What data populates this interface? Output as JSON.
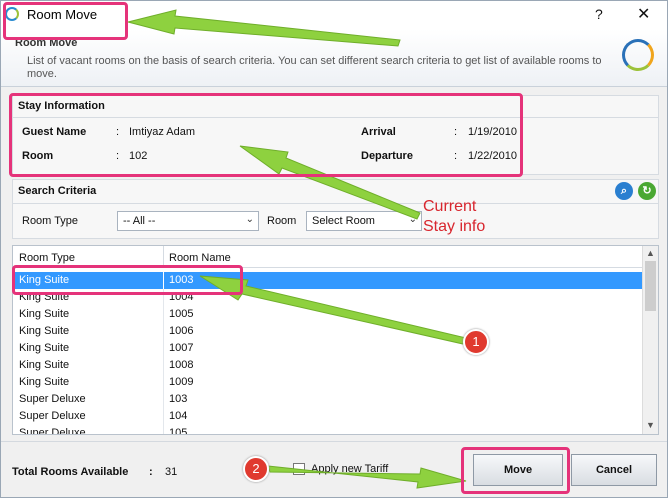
{
  "window": {
    "title": "Room Move",
    "help": "?",
    "close": "✕"
  },
  "header": {
    "title": "Room Move",
    "description": "List of vacant rooms on the basis of search criteria. You can set different search criteria to get list of available rooms to move."
  },
  "stay": {
    "title": "Stay Information",
    "guest_label": "Guest Name",
    "guest_value": "Imtiyaz Adam",
    "room_label": "Room",
    "room_value": "102",
    "arrival_label": "Arrival",
    "arrival_value": "1/19/2010",
    "departure_label": "Departure",
    "departure_value": "1/22/2010",
    "colon": ":"
  },
  "search": {
    "title": "Search Criteria",
    "room_type_label": "Room Type",
    "room_type_value": "-- All --",
    "room_label": "Room",
    "room_value": "Select Room"
  },
  "grid": {
    "headers": [
      "Room Type",
      "Room Name"
    ],
    "rows": [
      [
        "King Suite",
        "1003"
      ],
      [
        "King Suite",
        "1004"
      ],
      [
        "King Suite",
        "1005"
      ],
      [
        "King Suite",
        "1006"
      ],
      [
        "King Suite",
        "1007"
      ],
      [
        "King Suite",
        "1008"
      ],
      [
        "King Suite",
        "1009"
      ],
      [
        "Super Deluxe",
        "103"
      ],
      [
        "Super Deluxe",
        "104"
      ],
      [
        "Super Deluxe",
        "105"
      ]
    ]
  },
  "footer": {
    "total_label": "Total Rooms Available",
    "total_colon": ":",
    "total_value": "31",
    "tariff_label": "Apply new Tariff",
    "move_label": "Move",
    "cancel_label": "Cancel"
  },
  "annotations": {
    "current_stay_line1": "Current",
    "current_stay_line2": "Stay info",
    "step1": "1",
    "step2": "2",
    "box_color": "#e5337a",
    "arrow_color": "#8ed13f"
  }
}
